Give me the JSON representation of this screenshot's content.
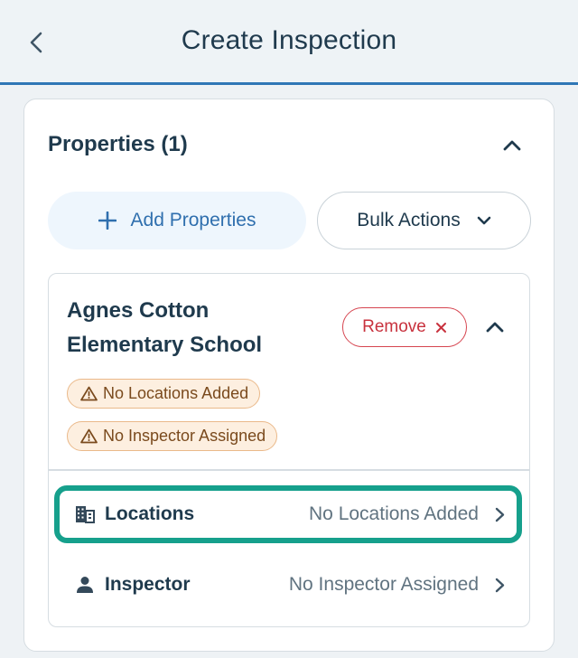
{
  "header": {
    "title": "Create Inspection",
    "back_icon": "chevron-left-icon"
  },
  "properties_section": {
    "title": "Properties (1)",
    "collapse_icon": "chevron-up-icon",
    "add_button_label": "Add Properties",
    "add_icon": "plus-icon",
    "bulk_button_label": "Bulk Actions",
    "bulk_icon": "chevron-down-icon"
  },
  "property": {
    "name": "Agnes Cotton Elementary School",
    "remove_label": "Remove",
    "remove_icon": "close-icon",
    "warnings": [
      {
        "text": "No Locations Added",
        "icon": "warning-icon"
      },
      {
        "text": "No Inspector Assigned",
        "icon": "warning-icon"
      }
    ],
    "rows": [
      {
        "label": "Locations",
        "value": "No Locations Added",
        "icon": "building-icon",
        "highlighted": true
      },
      {
        "label": "Inspector",
        "value": "No Inspector Assigned",
        "icon": "person-icon",
        "highlighted": false
      }
    ]
  },
  "colors": {
    "accent_blue": "#2f77b6",
    "highlight_teal": "#16a08c",
    "remove_red": "#d64550",
    "warning_bg": "#fdefe0",
    "warning_border": "#eab98a"
  }
}
